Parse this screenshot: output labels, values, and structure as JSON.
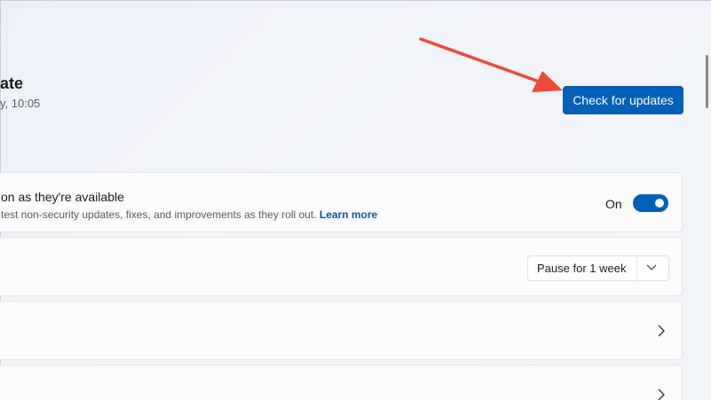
{
  "header": {
    "title": "ate",
    "subtitle": "y, 10:05",
    "check_button_label": "Check for updates"
  },
  "cards": {
    "latest_updates": {
      "title": "on as they're available",
      "description": "test non-security updates, fixes, and improvements as they roll out.",
      "learn_more": "Learn more",
      "toggle_label": "On",
      "toggle_state": true
    },
    "pause_updates": {
      "selected_option": "Pause for 1 week"
    }
  },
  "colors": {
    "accent": "#005fb8",
    "annotation_arrow": "#ee4a36",
    "link": "#0a58a8"
  },
  "icons": {
    "pause_dropdown": "chevron-down-icon",
    "row_nav": "chevron-right-icon",
    "annotation": "arrow-annotation"
  }
}
